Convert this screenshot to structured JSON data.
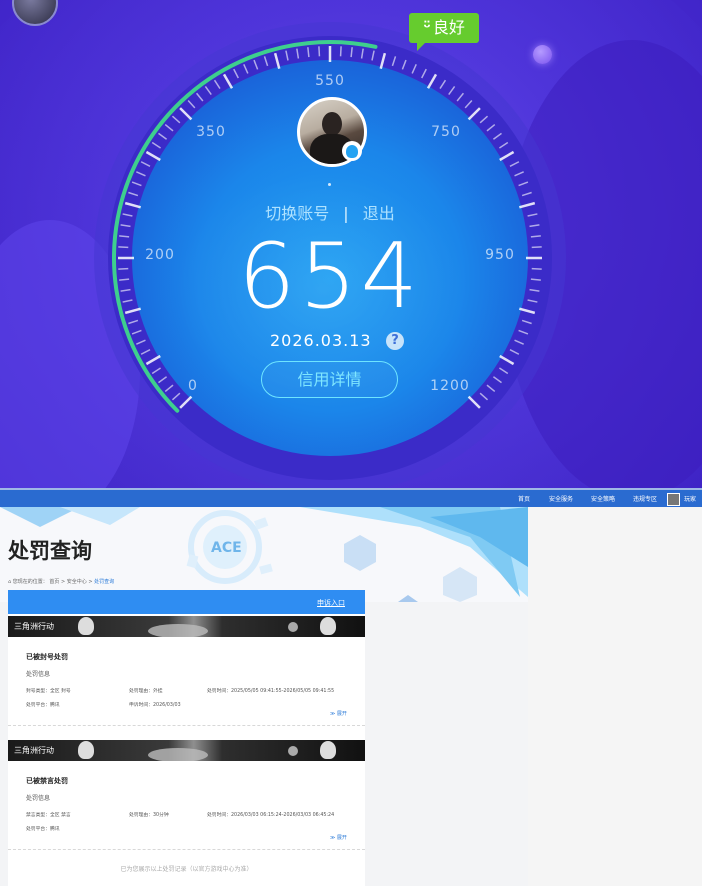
{
  "credit": {
    "rating_badge": "良好",
    "ticks": [
      "0",
      "200",
      "350",
      "550",
      "750",
      "950",
      "1200"
    ],
    "switch_account": "切换账号",
    "separator": "|",
    "logout": "退出",
    "score": "654",
    "score_progress": 0.545,
    "date": "2026.03.13",
    "help": "?",
    "detail_button": "信用详情"
  },
  "nav": {
    "items": [
      "首页",
      "安全服务",
      "安全策略",
      "违规专区"
    ],
    "username": "玩家"
  },
  "page": {
    "title": "处罚查询",
    "breadcrumb": {
      "prefix": "您现在的位置：",
      "crumbs": [
        "首页",
        "安全中心"
      ],
      "current": "处罚查询"
    }
  },
  "panel": {
    "header_link": "申诉入口",
    "records": [
      {
        "banner": "三角洲行动",
        "title": "已被封号处罚",
        "subtitle": "处罚信息",
        "fields": {
          "account": "封号类型：全区 封号",
          "reason": "处罚理由：外挂",
          "time": "处罚时间：2025/05/05 09:41:55-2026/05/05 09:41:55",
          "platform": "处罚平台：腾讯",
          "appeal": "申诉时间：2026/03/03"
        },
        "expand": "展开"
      },
      {
        "banner": "三角洲行动",
        "title": "已被禁言处罚",
        "subtitle": "处罚信息",
        "fields": {
          "account": "禁言类型：全区 禁言",
          "reason": "处罚理由：30分钟",
          "time": "处罚时间：2026/03/03 06:15:24-2026/03/03 06:45:24",
          "platform": "处罚平台：腾讯"
        },
        "expand": "展开"
      }
    ],
    "footer": "已为您展示以上处罚记录（以官方游戏中心为准）"
  },
  "colors": {
    "purple_bg": "#4a2ed6",
    "dial_blue": "#1b86ea",
    "green_badge": "#66cc2e",
    "progress_green": "#3ecf8e",
    "nav_blue": "#2a6bd0",
    "panel_blue": "#2f8df2"
  }
}
